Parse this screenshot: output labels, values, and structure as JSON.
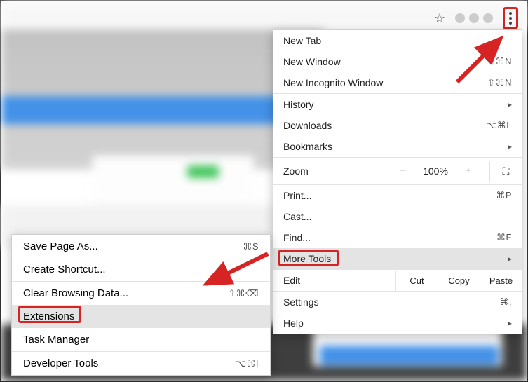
{
  "menu": {
    "new_tab": "New Tab",
    "new_window": "New Window",
    "new_window_sc": "⌘N",
    "incognito": "New Incognito Window",
    "incognito_sc": "⇧⌘N",
    "history": "History",
    "downloads": "Downloads",
    "downloads_sc": "⌥⌘L",
    "bookmarks": "Bookmarks",
    "zoom_label": "Zoom",
    "zoom_minus": "−",
    "zoom_value": "100%",
    "zoom_plus": "+",
    "print": "Print...",
    "print_sc": "⌘P",
    "cast": "Cast...",
    "find": "Find...",
    "find_sc": "⌘F",
    "more_tools": "More Tools",
    "edit": "Edit",
    "cut": "Cut",
    "copy": "Copy",
    "paste": "Paste",
    "settings": "Settings",
    "settings_sc": "⌘,",
    "help": "Help"
  },
  "submenu": {
    "save_page": "Save Page As...",
    "save_page_sc": "⌘S",
    "create_shortcut": "Create Shortcut...",
    "clear_data": "Clear Browsing Data...",
    "clear_data_sc": "⇧⌘⌫",
    "extensions": "Extensions",
    "task_manager": "Task Manager",
    "dev_tools": "Developer Tools",
    "dev_tools_sc": "⌥⌘I"
  }
}
